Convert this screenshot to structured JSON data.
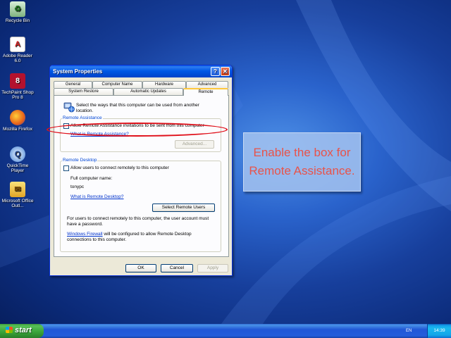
{
  "desktop": {
    "icons": [
      {
        "label": "Recycle Bin",
        "icon": "recycle-bin-icon"
      },
      {
        "label": "Adobe Reader 6.0",
        "icon": "adobe-reader-icon"
      },
      {
        "label": "TechPaint Shop Pro 8",
        "icon": "paint-shop-icon"
      },
      {
        "label": "Mozilla Firefox",
        "icon": "firefox-icon"
      },
      {
        "label": "QuickTime Player",
        "icon": "quicktime-icon"
      },
      {
        "label": "Microsoft Office Outl...",
        "icon": "outlook-icon"
      }
    ]
  },
  "dialog": {
    "title": "System Properties",
    "help_label": "?",
    "close_label": "✕",
    "tabs_row1": [
      "General",
      "Computer Name",
      "Hardware",
      "Advanced"
    ],
    "tabs_row2": [
      "System Restore",
      "Automatic Updates",
      "Remote"
    ],
    "active_tab": "Remote",
    "intro_line1": "Select the ways that this computer can be used from another",
    "intro_line2": "location.",
    "remote_assistance": {
      "group_label": "Remote Assistance",
      "checkbox_label": "Allow Remote Assistance invitations to be sent from this computer",
      "checked": false,
      "link": "What is Remote Assistance?",
      "advanced_label": "Advanced..."
    },
    "remote_desktop": {
      "group_label": "Remote Desktop",
      "checkbox_label": "Allow users to connect remotely to this computer",
      "checked": false,
      "full_name_label": "Full computer name:",
      "full_name_value": "tonypc",
      "link": "What is Remote Desktop?",
      "select_users_label": "Select Remote Users",
      "note_line1": "For users to connect remotely to this computer, the user account must",
      "note_line2": "have a password.",
      "firewall_link": "Windows Firewall",
      "firewall_line1_rest": " will be configured to allow Remote Desktop",
      "firewall_line2": "connections to this computer."
    },
    "ok_label": "OK",
    "cancel_label": "Cancel",
    "apply_label": "Apply"
  },
  "callout": {
    "text": "Enable the box for Remote Assistance.",
    "color": "#e8534a"
  },
  "taskbar": {
    "start_label": "start",
    "language": "EN",
    "clock": "14:39"
  },
  "colors": {
    "titlebar": "#0058e6",
    "highlight": "#e0101a",
    "link": "#0033cc"
  }
}
